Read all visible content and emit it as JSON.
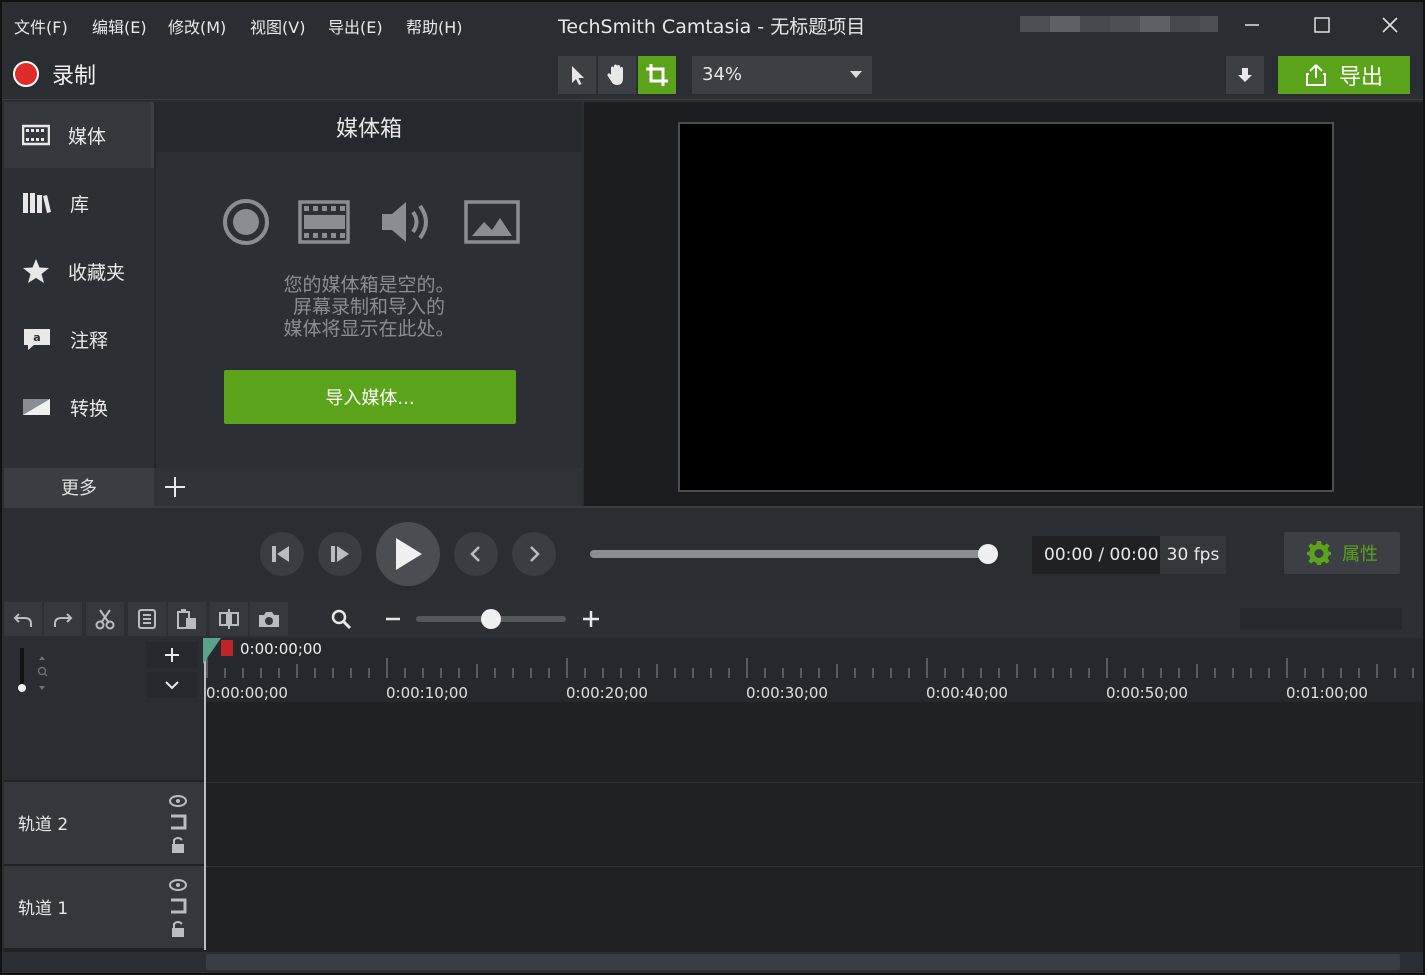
{
  "menu": {
    "file": "文件(F)",
    "edit": "编辑(E)",
    "modify": "修改(M)",
    "view": "视图(V)",
    "export": "导出(E)",
    "help": "帮助(H)"
  },
  "app_title": "TechSmith Camtasia - 无标题项目",
  "toolbar": {
    "record_label": "录制",
    "zoom_value": "34%",
    "export_label": "导出"
  },
  "tabs": [
    {
      "label": "媒体",
      "icon": "film-strip-icon"
    },
    {
      "label": "库",
      "icon": "library-books-icon"
    },
    {
      "label": "收藏夹",
      "icon": "star-icon"
    },
    {
      "label": "注释",
      "icon": "annotation-icon"
    },
    {
      "label": "转换",
      "icon": "transition-icon"
    }
  ],
  "more_label": "更多",
  "media_bin": {
    "title": "媒体箱",
    "empty_lines": [
      "您的媒体箱是空的。",
      "屏幕录制和导入的",
      "媒体将显示在此处。"
    ],
    "import_button": "导入媒体..."
  },
  "playback": {
    "time_current": "00:00",
    "time_separator": "/",
    "time_total": "00:00",
    "fps": "30 fps",
    "properties_label": "属性",
    "scrub_progress": 1.0
  },
  "timeline": {
    "playhead_time": "0:00:00;00",
    "ruler_labels": [
      "0:00:00;00",
      "0:00:10;00",
      "0:00:20;00",
      "0:00:30;00",
      "0:00:40;00",
      "0:00:50;00",
      "0:01:00;00"
    ],
    "zoom_level": 0.5,
    "tracks": [
      {
        "name": "轨道 2"
      },
      {
        "name": "轨道 1"
      }
    ]
  },
  "colors": {
    "accent": "#5aa31a",
    "record": "#e02b2b"
  }
}
